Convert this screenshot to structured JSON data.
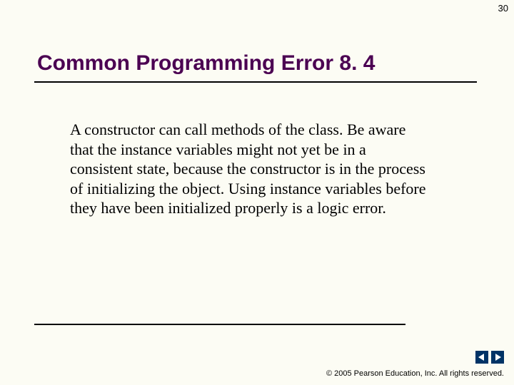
{
  "page_number": "30",
  "title": "Common Programming Error 8. 4",
  "body": "A constructor can call methods of the class. Be aware that the instance variables might not yet be in a consistent state, because the constructor is in the process of initializing the object. Using instance variables before they have been initialized properly is a logic error.",
  "copyright": "© 2005 Pearson Education, Inc. All rights reserved.",
  "colors": {
    "title": "#4b0052",
    "background": "#fcfcf4",
    "nav_button": "#003366"
  }
}
